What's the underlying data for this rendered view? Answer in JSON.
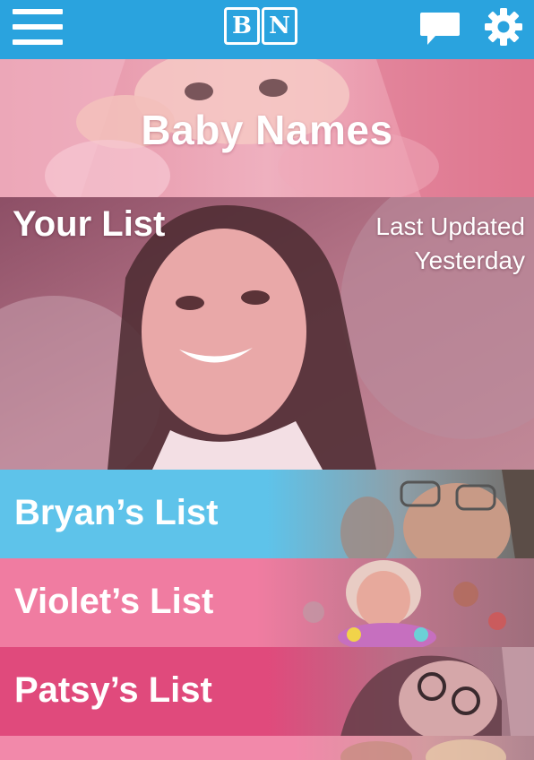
{
  "header": {
    "menu_icon": "hamburger-menu-icon",
    "logo_letters": [
      "B",
      "N"
    ],
    "chat_icon": "chat-bubble-icon",
    "settings_icon": "gear-icon",
    "bar_color": "#2aa3de"
  },
  "hero": {
    "title": "Baby Names",
    "overlay_color": "#e99aab"
  },
  "your_list": {
    "title": "Your List",
    "updated_label": "Last Updated",
    "updated_value": "Yesterday",
    "overlay_color": "#a9677c"
  },
  "friend_lists": [
    {
      "label": "Bryan’s List",
      "color": "#5ec3ea"
    },
    {
      "label": "Violet’s List",
      "color": "#f07ca1"
    },
    {
      "label": "Patsy’s List",
      "color": "#e04a7c"
    }
  ],
  "partial_next": {
    "color": "#f289aa"
  }
}
